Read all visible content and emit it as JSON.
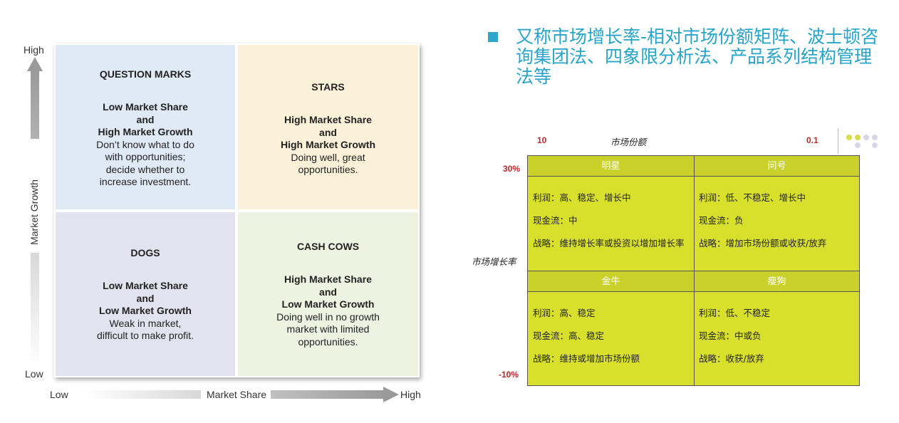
{
  "bcg": {
    "y_high": "High",
    "y_low": "Low",
    "y_axis_label": "Market Growth",
    "x_low": "Low",
    "x_high": "High",
    "x_axis_label": "Market Share",
    "q1": {
      "title": "QUESTION MARKS",
      "line1": "Low Market Share",
      "line2": "and",
      "line3": "High Market Growth",
      "desc1": "Don’t know what to do",
      "desc2": "with opportunities;",
      "desc3": "decide whether to",
      "desc4": "increase investment."
    },
    "q2": {
      "title": "STARS",
      "line1": "High Market Share",
      "line2": "and",
      "line3": "High Market Growth",
      "desc1": "Doing well, great",
      "desc2": "opportunities."
    },
    "q3": {
      "title": "DOGS",
      "line1": "Low Market Share",
      "line2": "and",
      "line3": "Low Market Growth",
      "desc1": "Weak in market,",
      "desc2": "difficult to make profit."
    },
    "q4": {
      "title": "CASH COWS",
      "line1": "High Market Share",
      "line2": "and",
      "line3": "Low Market Growth",
      "desc1": "Doing well in no growth",
      "desc2": "market with limited",
      "desc3": "opportunities."
    }
  },
  "headline": "又称市场增长率-相对市场份额矩阵、波士顿咨询集团法、四象限分析法、产品系列结构管理法等",
  "cn_matrix": {
    "share_left": "10",
    "share_label": "市场份额",
    "share_right": "0.1",
    "growth_top": "30%",
    "growth_label": "市场增长率",
    "growth_bottom": "-10%",
    "star": {
      "title": "明星",
      "profit": "利润：高、稳定、增长中",
      "cash": "现金流：中",
      "strategy": "战略：维持增长率或投资以增加增长率"
    },
    "question": {
      "title": "问号",
      "profit": "利润：低、不稳定、增长中",
      "cash": "现金流：负",
      "strategy": "战略：增加市场份额或收获/放弃"
    },
    "cow": {
      "title": "金牛",
      "profit": "利润：高、稳定",
      "cash": "现金流：高、稳定",
      "strategy": "战略：维持或增加市场份额"
    },
    "dog": {
      "title": "瘦狗",
      "profit": "利润：低、不稳定",
      "cash": "现金流：中或负",
      "strategy": "战略：收获/放弃"
    }
  },
  "colors": {
    "accent": "#27a4c8",
    "table_fill": "#d8e02c",
    "red_label": "#c0272d"
  }
}
